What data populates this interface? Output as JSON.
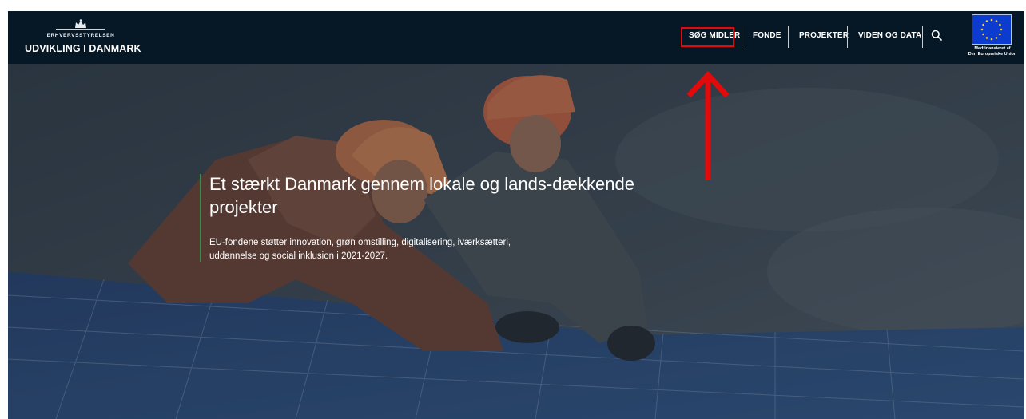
{
  "header": {
    "org_name": "Erhvervsstyrelsen",
    "brand": "UDVIKLING I DANMARK",
    "nav": [
      {
        "label": "SØG MIDLER"
      },
      {
        "label": "FONDE"
      },
      {
        "label": "PROJEKTER"
      },
      {
        "label": "VIDEN OG DATA"
      }
    ],
    "search_icon": "search-icon",
    "eu_caption_line1": "Medfinansieret af",
    "eu_caption_line2": "Den Europæiske Union"
  },
  "hero": {
    "title": "Et stærkt Danmark gennem lokale og lands-dækkende projekter",
    "body": "EU-fondene støtter innovation, grøn omstilling, digitalisering, iværksætteri, uddannelse og social inklusion i 2021-2027."
  },
  "annotation": {
    "highlight_color": "#e20a0a",
    "target": "SØG MIDLER"
  }
}
